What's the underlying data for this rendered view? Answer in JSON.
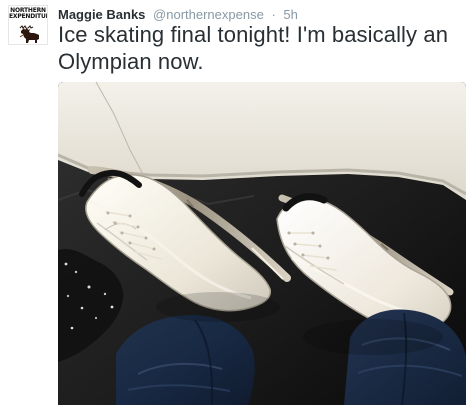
{
  "tweet": {
    "avatar": {
      "logo_text": "NORTHERN\nEXPENDITURE",
      "icon": "moose-logo"
    },
    "author": {
      "name": "Maggie Banks",
      "handle": "@northernexpense",
      "separator": "·",
      "timestamp": "5h"
    },
    "text": "Ice skating final tonight! I'm basically an Olympian now.",
    "media": {
      "type": "photo",
      "subject": "white ice skates"
    }
  },
  "colors": {
    "text_primary": "#292f33",
    "text_secondary": "#8899a6",
    "background": "#ffffff"
  }
}
